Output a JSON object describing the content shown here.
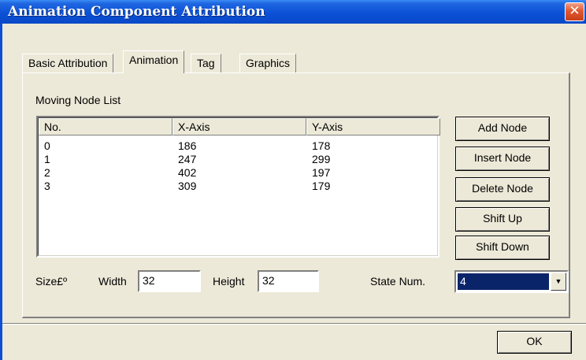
{
  "window": {
    "title": "Animation Component Attribution",
    "close_glyph": "✕"
  },
  "tabs": [
    {
      "label": "Basic Attribution",
      "active": false
    },
    {
      "label": "Animation",
      "active": true
    },
    {
      "label": "Tag",
      "active": false
    },
    {
      "label": "Graphics",
      "active": false
    }
  ],
  "node_list": {
    "group_label": "Moving Node List",
    "columns": [
      "No.",
      "X-Axis",
      "Y-Axis"
    ],
    "rows": [
      [
        "0",
        "186",
        "178"
      ],
      [
        "1",
        "247",
        "299"
      ],
      [
        "2",
        "402",
        "197"
      ],
      [
        "3",
        "309",
        "179"
      ]
    ]
  },
  "buttons": {
    "add_node": "Add Node",
    "insert_node": "Insert Node",
    "delete_node": "Delete Node",
    "shift_up": "Shift Up",
    "shift_down": "Shift Down",
    "ok": "OK"
  },
  "size": {
    "label": "Size£º",
    "width_label": "Width",
    "width_value": "32",
    "height_label": "Height",
    "height_value": "32"
  },
  "state": {
    "label": "State Num.",
    "value": "4",
    "dropdown_glyph": "▼"
  },
  "colors": {
    "title_bar": "#0a4fd6",
    "close_button": "#e0582e",
    "selection": "#0a246a",
    "face": "#ece9d8"
  }
}
